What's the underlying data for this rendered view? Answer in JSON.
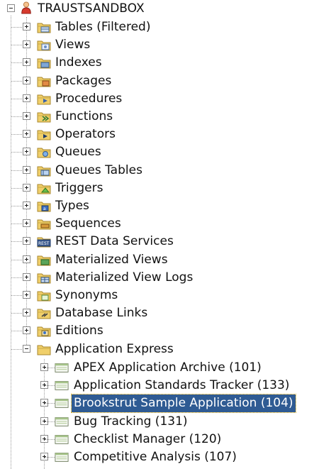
{
  "tree": {
    "root": {
      "label": "TRAUSTSANDBOX",
      "icon": "user-icon"
    },
    "categories": [
      {
        "label": "Tables (Filtered)",
        "icon": "tables-folder-icon",
        "expanded": false
      },
      {
        "label": "Views",
        "icon": "views-folder-icon",
        "expanded": false
      },
      {
        "label": "Indexes",
        "icon": "indexes-folder-icon",
        "expanded": false
      },
      {
        "label": "Packages",
        "icon": "packages-folder-icon",
        "expanded": false
      },
      {
        "label": "Procedures",
        "icon": "procedures-folder-icon",
        "expanded": false
      },
      {
        "label": "Functions",
        "icon": "functions-folder-icon",
        "expanded": false
      },
      {
        "label": "Operators",
        "icon": "operators-folder-icon",
        "expanded": false
      },
      {
        "label": "Queues",
        "icon": "queues-folder-icon",
        "expanded": false
      },
      {
        "label": "Queues Tables",
        "icon": "queues-tables-folder-icon",
        "expanded": false
      },
      {
        "label": "Triggers",
        "icon": "triggers-folder-icon",
        "expanded": false
      },
      {
        "label": "Types",
        "icon": "types-folder-icon",
        "expanded": false
      },
      {
        "label": "Sequences",
        "icon": "sequences-folder-icon",
        "expanded": false
      },
      {
        "label": "REST Data Services",
        "icon": "rest-folder-icon",
        "expanded": false
      },
      {
        "label": "Materialized Views",
        "icon": "materialized-views-folder-icon",
        "expanded": false
      },
      {
        "label": "Materialized View Logs",
        "icon": "materialized-view-logs-folder-icon",
        "expanded": false
      },
      {
        "label": "Synonyms",
        "icon": "synonyms-folder-icon",
        "expanded": false
      },
      {
        "label": "Database Links",
        "icon": "database-links-folder-icon",
        "expanded": false
      },
      {
        "label": "Editions",
        "icon": "editions-folder-icon",
        "expanded": false
      },
      {
        "label": "Application Express",
        "icon": "application-express-folder-icon",
        "expanded": true
      }
    ],
    "apex_apps": [
      {
        "label": "APEX Application Archive (101)",
        "selected": false
      },
      {
        "label": "Application Standards Tracker (133)",
        "selected": false
      },
      {
        "label": "Brookstrut Sample Application (104)",
        "selected": true
      },
      {
        "label": "Bug Tracking (131)",
        "selected": false
      },
      {
        "label": "Checklist Manager (120)",
        "selected": false
      },
      {
        "label": "Competitive Analysis (107)",
        "selected": false
      }
    ],
    "colors": {
      "selection_bg": "#2f5b93",
      "selection_border": "#d9a200",
      "folder_yellow": "#f0cf6a"
    }
  }
}
